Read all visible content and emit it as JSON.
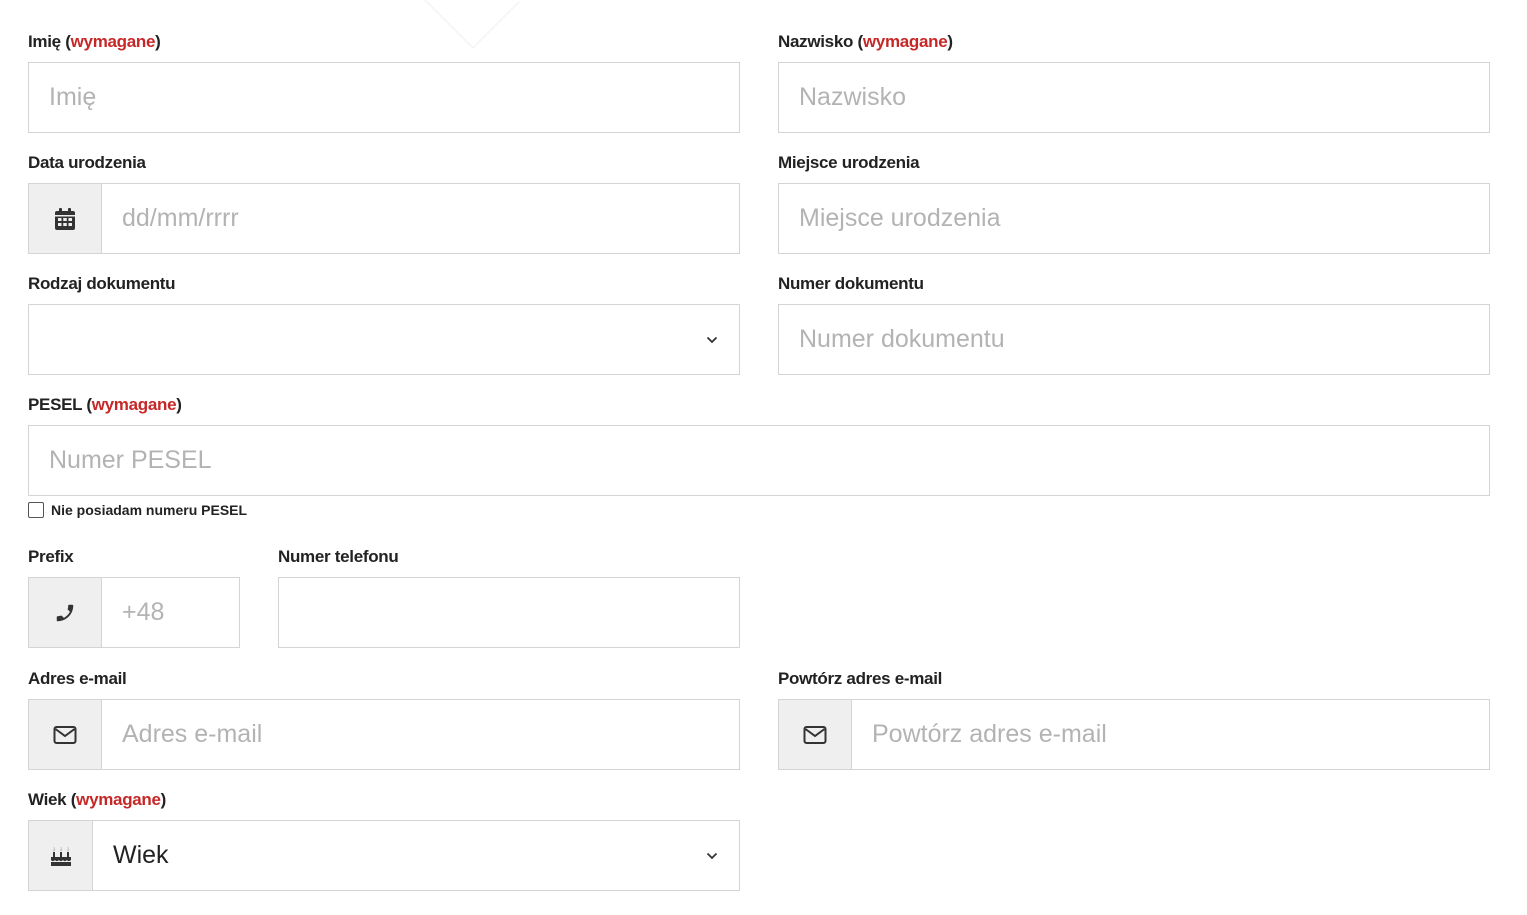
{
  "required_marker": "wymagane",
  "fields": {
    "first_name": {
      "label": "Imię",
      "placeholder": "Imię"
    },
    "last_name": {
      "label": "Nazwisko",
      "placeholder": "Nazwisko"
    },
    "birth_date": {
      "label": "Data urodzenia",
      "placeholder": "dd/mm/rrrr",
      "icon": "calendar-icon"
    },
    "birth_place": {
      "label": "Miejsce urodzenia",
      "placeholder": "Miejsce urodzenia"
    },
    "document_type": {
      "label": "Rodzaj dokumentu",
      "value": ""
    },
    "document_number": {
      "label": "Numer dokumentu",
      "placeholder": "Numer dokumentu"
    },
    "pesel": {
      "label": "PESEL",
      "placeholder": "Numer PESEL",
      "checkbox_label": "Nie posiadam numeru PESEL",
      "checked": false
    },
    "prefix": {
      "label": "Prefix",
      "placeholder": "+48",
      "icon": "phone-icon"
    },
    "phone": {
      "label": "Numer telefonu",
      "placeholder": ""
    },
    "email": {
      "label": "Adres e-mail",
      "placeholder": "Adres e-mail",
      "icon": "envelope-icon"
    },
    "email_repeat": {
      "label": "Powtórz adres e-mail",
      "placeholder": "Powtórz adres e-mail",
      "icon": "envelope-icon"
    },
    "age": {
      "label": "Wiek",
      "value": "Wiek",
      "icon": "birthday-cake-icon"
    }
  },
  "colors": {
    "required": "#c62828",
    "border": "#d4d4d4",
    "addon_bg": "#efefef",
    "placeholder": "#b3b3b3"
  }
}
